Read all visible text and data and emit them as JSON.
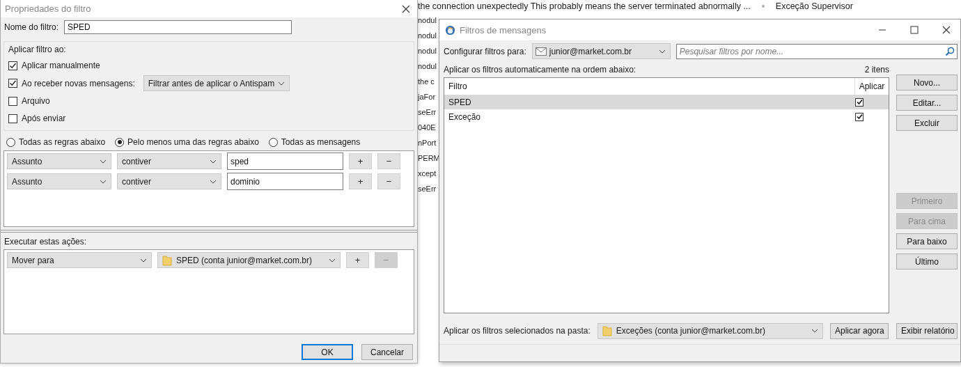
{
  "background_list": {
    "rows": [
      "the connection unexpectedly This probably means the server terminated abnormally ...",
      "nodul",
      "nodul",
      "nodul",
      "nodul",
      "the c",
      "jaFor",
      "seErr",
      "040E",
      "nPort",
      "PERM",
      "xcept",
      "seErr"
    ],
    "first_row_tag": "Exceção Supervisor"
  },
  "filter_dialog": {
    "title": "Propriedades do filtro",
    "name_label": "Nome do filtro:",
    "name_value": "SPED",
    "apply_group": {
      "label": "Aplicar filtro ao:",
      "options": [
        {
          "label": "Aplicar manualmente",
          "checked": true
        },
        {
          "label": "Ao receber novas mensagens:",
          "checked": true,
          "dropdown": "Filtrar antes de aplicar o Antispam"
        },
        {
          "label": "Arquivo",
          "checked": false
        },
        {
          "label": "Após enviar",
          "checked": false
        }
      ]
    },
    "match_options": [
      {
        "label": "Todas as regras abaixo",
        "selected": false
      },
      {
        "label": "Pelo menos uma das regras abaixo",
        "selected": true
      },
      {
        "label": "Todas as mensagens",
        "selected": false
      }
    ],
    "rules": [
      {
        "field": "Assunto",
        "operator": "contiver",
        "value": "sped",
        "add": "+",
        "remove": "−",
        "remove_disabled": false
      },
      {
        "field": "Assunto",
        "operator": "contiver",
        "value": "dominio",
        "add": "+",
        "remove": "−",
        "remove_disabled": false
      }
    ],
    "actions_label": "Executar estas ações:",
    "actions": [
      {
        "action": "Mover para",
        "target": "SPED (conta junior@market.com.br)",
        "add": "+",
        "remove": "−",
        "remove_disabled": true
      }
    ],
    "buttons": [
      {
        "label": "OK",
        "default": true
      },
      {
        "label": "Cancelar",
        "default": false
      }
    ]
  },
  "filters_window": {
    "title": "Filtros de mensagens",
    "account_label": "Configurar filtros para:",
    "account": "junior@market.com.br",
    "search_placeholder": "Pesquisar filtros por nome...",
    "list_label": "Aplicar os filtros automaticamente na ordem abaixo:",
    "count": "2 itens",
    "columns": [
      "Filtro",
      "Aplicar"
    ],
    "rows": [
      {
        "name": "SPED",
        "enabled": true,
        "selected": true
      },
      {
        "name": "Exceção",
        "enabled": true,
        "selected": false
      }
    ],
    "side_buttons": [
      {
        "label": "Novo...",
        "kind": "edit",
        "disabled": false
      },
      {
        "label": "Editar...",
        "kind": "edit",
        "disabled": false
      },
      {
        "label": "Excluir",
        "kind": "edit",
        "disabled": false
      },
      {
        "label": "Primeiro",
        "kind": "order",
        "disabled": true
      },
      {
        "label": "Para cima",
        "kind": "order",
        "disabled": true
      },
      {
        "label": "Para baixo",
        "kind": "order",
        "disabled": false
      },
      {
        "label": "Último",
        "kind": "order",
        "disabled": false
      }
    ],
    "folder_label": "Aplicar os filtros selecionados na pasta:",
    "folder": "Exceções (conta junior@market.com.br)",
    "apply_button": "Aplicar agora",
    "report_button": "Exibir relatório"
  }
}
